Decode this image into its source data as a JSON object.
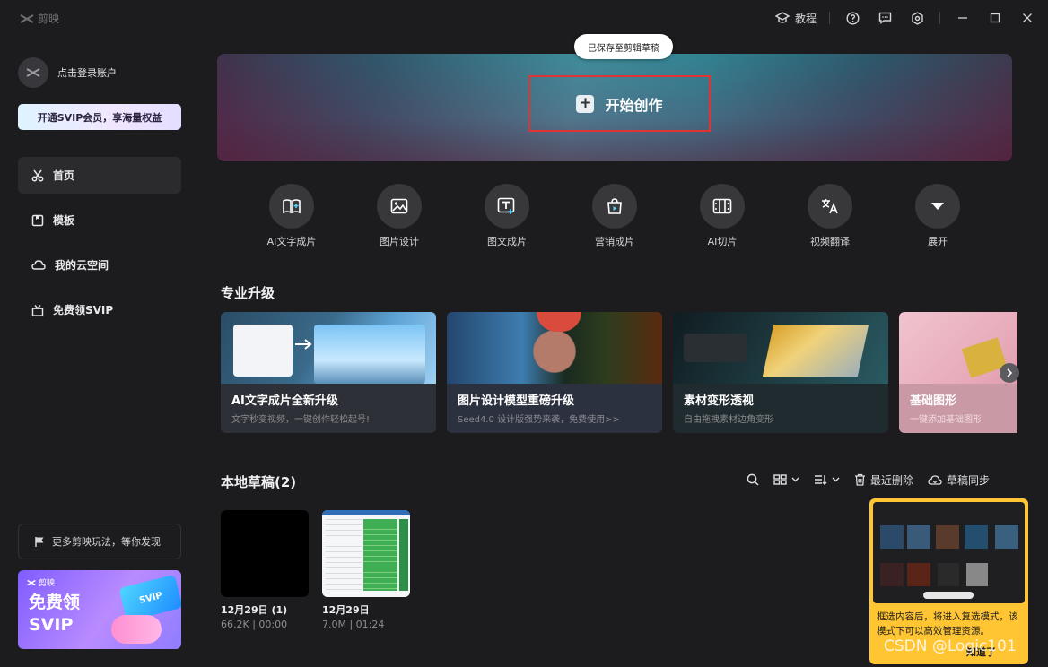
{
  "app": {
    "name": "剪映"
  },
  "titlebar": {
    "tutorial": "教程"
  },
  "account": {
    "login": "点击登录账户"
  },
  "svip_bar": "开通SVIP会员，享海量权益",
  "nav": [
    {
      "label": "首页"
    },
    {
      "label": "模板"
    },
    {
      "label": "我的云空间"
    },
    {
      "label": "免费领SVIP"
    }
  ],
  "more": "更多剪映玩法，等你发现",
  "promo": {
    "brand": "剪映",
    "line1": "免费领",
    "line2": "SVIP",
    "card": "SVIP"
  },
  "toast": "已保存至剪辑草稿",
  "hero": {
    "start": "开始创作"
  },
  "tools": [
    {
      "label": "AI文字成片",
      "icon": "ai-text-video-icon"
    },
    {
      "label": "图片设计",
      "icon": "image-design-icon"
    },
    {
      "label": "图文成片",
      "icon": "image-text-video-icon"
    },
    {
      "label": "营销成片",
      "icon": "marketing-video-icon"
    },
    {
      "label": "AI切片",
      "icon": "ai-slice-icon"
    },
    {
      "label": "视频翻译",
      "icon": "video-translate-icon"
    },
    {
      "label": "展开",
      "icon": "expand-icon"
    }
  ],
  "section_pro": "专业升级",
  "cards": [
    {
      "title": "AI文字成片全新升级",
      "sub": "文字秒变视频，一键创作轻松起号!"
    },
    {
      "title": "图片设计模型重磅升级",
      "sub": "Seed4.0 设计版强势来袭，免费使用>>"
    },
    {
      "title": "素材变形透视",
      "sub": "自由拖拽素材边角变形"
    },
    {
      "title": "基础图形",
      "sub": "一键添加基础图形"
    }
  ],
  "drafts": {
    "title": "本地草稿(2)",
    "recent_delete": "最近删除",
    "sync": "草稿同步",
    "items": [
      {
        "name": "12月29日 (1)",
        "meta": "66.2K | 00:00"
      },
      {
        "name": "12月29日",
        "meta": "7.0M | 01:24"
      }
    ]
  },
  "tip": {
    "text": "框选内容后，将进入复选模式，该模式下可以高效管理资源。",
    "ok": "知道了"
  },
  "watermark": "CSDN @Logic101"
}
